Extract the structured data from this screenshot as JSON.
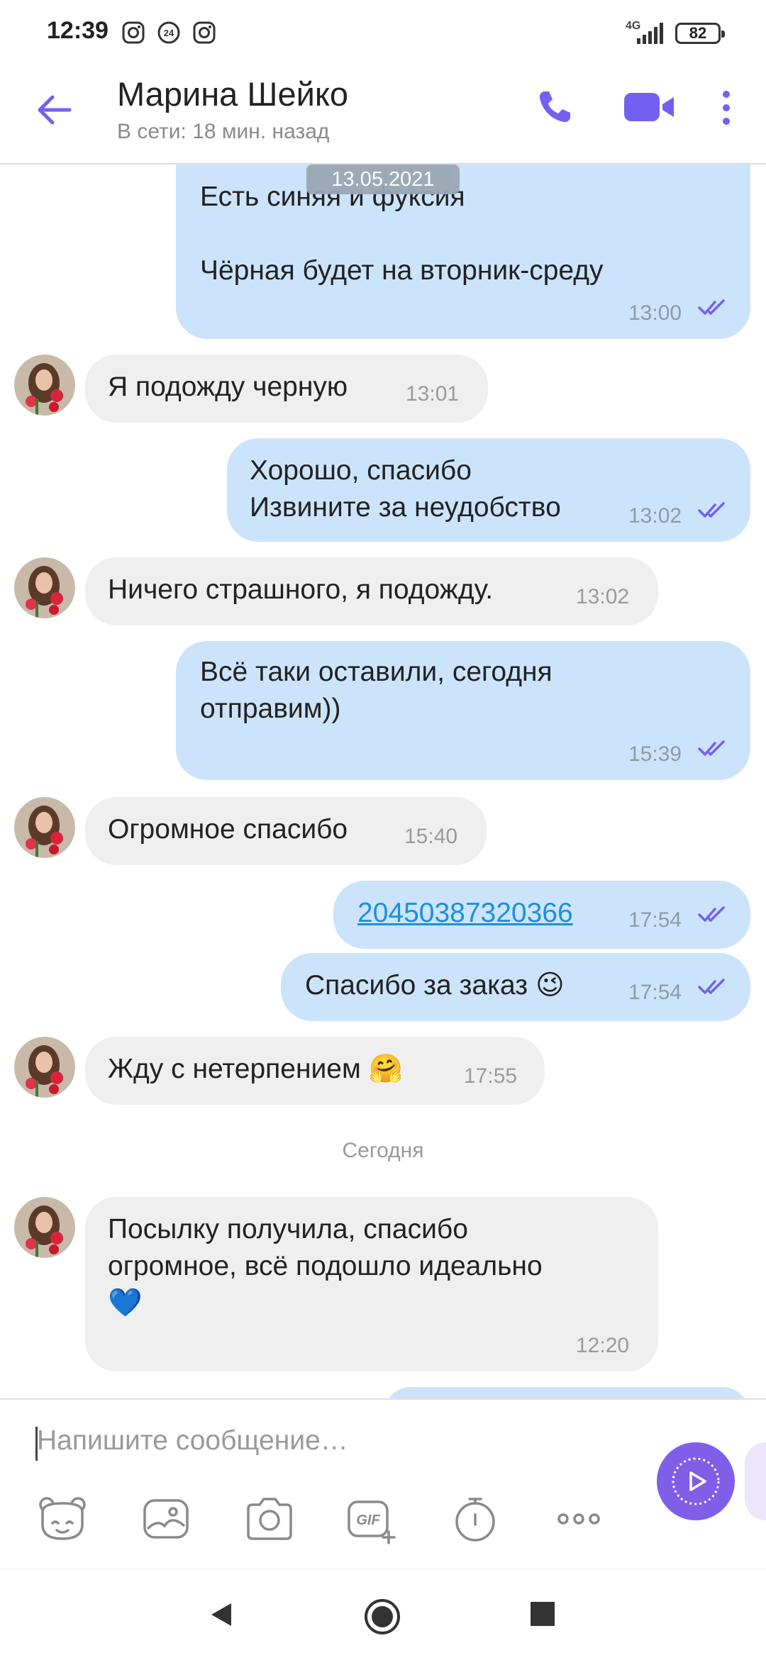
{
  "status_bar": {
    "time": "12:39",
    "network": "4G",
    "battery": "82",
    "icons": [
      "instagram-icon",
      "24-badge-icon",
      "instagram-icon",
      "signal-icon",
      "battery-icon"
    ]
  },
  "header": {
    "contact_name": "Марина Шейко",
    "status": "В сети: 18 мин. назад",
    "icons": [
      "back-arrow-icon",
      "phone-icon",
      "video-call-icon",
      "more-vert-icon"
    ],
    "accent": "#7360f2"
  },
  "chat": {
    "date_pill": "13.05.2021",
    "day_separator": "Сегодня",
    "messages": [
      {
        "dir": "out",
        "text": "Есть синяя и фуксия\n\nЧёрная будет на вторник-среду",
        "time": "13:00"
      },
      {
        "dir": "in",
        "text": "Я подожду черную",
        "time": "13:01"
      },
      {
        "dir": "out",
        "text": "Хорошо, спасибо\nИзвините за неудобство",
        "time": "13:02"
      },
      {
        "dir": "in",
        "text": "Ничего страшного, я подожду.",
        "time": "13:02"
      },
      {
        "dir": "out",
        "text": "Всё таки оставили, сегодня\nотправим))",
        "time": "15:39"
      },
      {
        "dir": "in",
        "text": "Огромное спасибо",
        "time": "15:40"
      },
      {
        "dir": "out",
        "text": "20450387320366",
        "time": "17:54",
        "link": true
      },
      {
        "dir": "out",
        "text": "Спасибо за заказ 😉",
        "time": "17:54"
      },
      {
        "dir": "in",
        "text": "Жду с нетерпением 🤗",
        "time": "17:55"
      },
      {
        "dir": "in",
        "text": "Посылку получила, спасибо\nогромное, всё подошло идеально\n💙",
        "time": "12:20"
      }
    ],
    "colors": {
      "outgoing": "#cce4fb",
      "incoming": "#efefef",
      "read_ticks": "#7360f2"
    }
  },
  "composer": {
    "placeholder": "Напишите сообщение…",
    "tools": [
      "sticker-icon",
      "gallery-icon",
      "camera-icon",
      "gif-icon",
      "timer-icon",
      "more-horizontal-icon"
    ],
    "send_icon": "send-video-message-icon",
    "send_color": "#7f5ee8"
  },
  "nav_bar": {
    "buttons": [
      "nav-back-icon",
      "nav-home-icon",
      "nav-recents-icon"
    ]
  }
}
